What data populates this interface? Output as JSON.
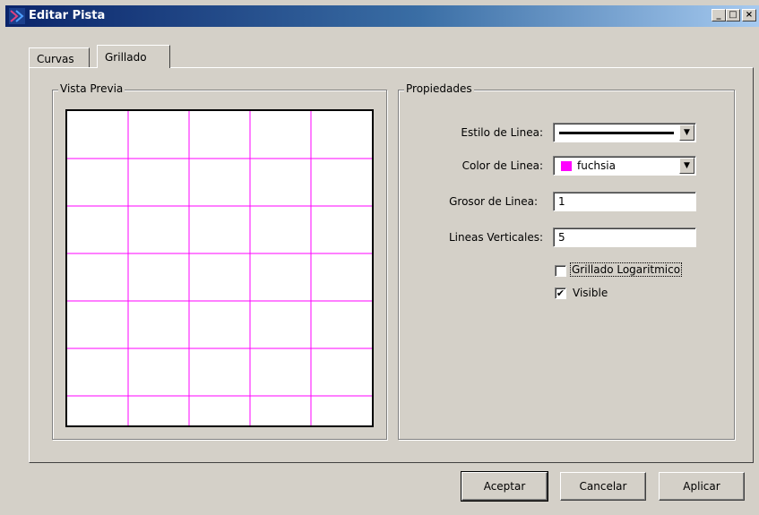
{
  "window": {
    "title": "Editar Pista",
    "minimize_label": "_",
    "maximize_label": "□",
    "close_label": "×"
  },
  "tabs": [
    {
      "label": "Curvas",
      "active": false
    },
    {
      "label": "Grillado",
      "active": true
    }
  ],
  "preview": {
    "title": "Vista Previa",
    "grid": {
      "vertical_lines": 5,
      "line_color": "#ff00ff",
      "line_width": 1
    }
  },
  "properties": {
    "title": "Propiedades",
    "line_style": {
      "label": "Estilo de Linea:",
      "value": "solid"
    },
    "line_color": {
      "label": "Color de Linea:",
      "value": "fuchsia",
      "swatch": "#ff00ff"
    },
    "line_width": {
      "label": "Grosor de Linea:",
      "value": "1"
    },
    "vertical_lines": {
      "label": "Lineas Verticales:",
      "value": "5"
    },
    "logarithmic_grid": {
      "label": "Grillado Logaritmico",
      "checked": false
    },
    "visible": {
      "label": "Visible",
      "checked": true
    }
  },
  "buttons": {
    "accept": "Aceptar",
    "cancel": "Cancelar",
    "apply": "Aplicar"
  },
  "colors": {
    "titlebar_start": "#0a246a",
    "titlebar_end": "#a6caf0",
    "face": "#d4d0c8",
    "grid": "#ff00ff"
  }
}
